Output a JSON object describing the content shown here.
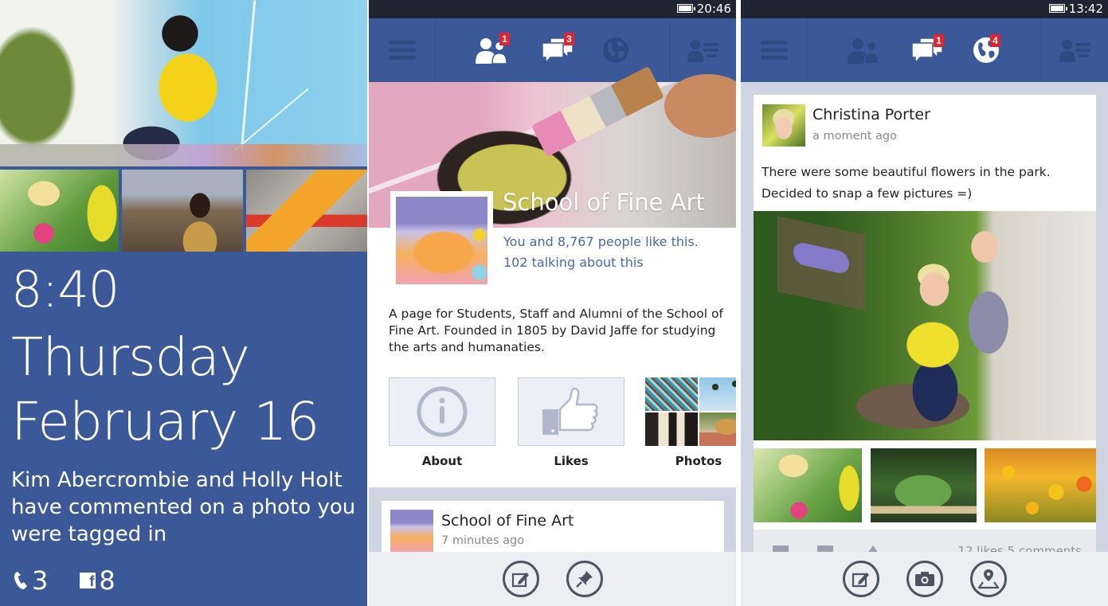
{
  "lock_screen": {
    "time": "8:40",
    "day": "Thursday",
    "date": "February 16",
    "notification": "Kim Abercrombie and Holly Holt have commented on a photo you were tagged in",
    "counts": [
      {
        "icon": "phone-icon",
        "value": "3"
      },
      {
        "icon": "facebook-icon",
        "value": "8"
      }
    ],
    "background_color": "#3b5998"
  },
  "page_screen": {
    "status": {
      "clock": "20:46",
      "battery_icon": "battery-icon"
    },
    "nav": {
      "menu_icon": "menu-icon",
      "items": [
        {
          "icon": "friend-requests-icon",
          "badge": "1",
          "active": true
        },
        {
          "icon": "messages-icon",
          "badge": "3",
          "active": true
        },
        {
          "icon": "notifications-globe-icon",
          "badge": "",
          "active": false
        }
      ],
      "contacts_icon": "contacts-list-icon"
    },
    "page": {
      "title": "School of Fine Art",
      "likes": "You and 8,767 people like this.",
      "talking": "102 talking about this",
      "description": "A page for Students, Staff and Alumni of the School of Fine Art. Founded in 1805 by David Jaffe for studying the arts and humanaties.",
      "tiles": [
        {
          "label": "About",
          "icon": "info-icon"
        },
        {
          "label": "Likes",
          "icon": "thumbs-up-icon"
        },
        {
          "label": "Photos",
          "icon": "photos-thumbnail"
        }
      ]
    },
    "post": {
      "author": "School of Fine Art",
      "time": "7 minutes ago"
    },
    "appbar": [
      {
        "icon": "compose-icon",
        "label": "Write post"
      },
      {
        "icon": "pin-icon",
        "label": "Pin to start"
      }
    ]
  },
  "feed_screen": {
    "status": {
      "clock": "13:42",
      "battery_icon": "battery-icon"
    },
    "nav": {
      "menu_icon": "menu-icon",
      "items": [
        {
          "icon": "friend-requests-icon",
          "badge": "",
          "active": false
        },
        {
          "icon": "messages-icon",
          "badge": "1",
          "active": true
        },
        {
          "icon": "notifications-globe-icon",
          "badge": "4",
          "active": true
        }
      ],
      "contacts_icon": "contacts-list-icon"
    },
    "post": {
      "author": "Christina Porter",
      "time": "a moment ago",
      "message_line1": "There were some beautiful flowers in the park.",
      "message_line2": "Decided to snap a few pictures =)",
      "stats": "12 likes  5 comments"
    },
    "appbar": [
      {
        "icon": "compose-icon",
        "label": "Status"
      },
      {
        "icon": "camera-icon",
        "label": "Photo"
      },
      {
        "icon": "check-in-icon",
        "label": "Check in"
      }
    ]
  },
  "colors": {
    "facebook_blue": "#3b5998",
    "status_bar": "#1f2533",
    "badge_red": "#e0232e",
    "link_blue": "#4a67a8",
    "feed_bg": "#cfd4e2",
    "appbar_bg": "#edeef2"
  }
}
